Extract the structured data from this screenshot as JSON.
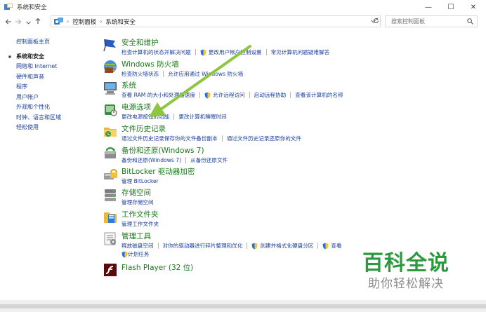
{
  "window": {
    "title": "系统和安全",
    "min_glyph": "—",
    "max_glyph": "☐",
    "close_glyph": "✕"
  },
  "address": {
    "breadcrumb": [
      "控制面板",
      "系统和安全"
    ],
    "search_placeholder": "搜索控制面板"
  },
  "sidebar": {
    "home": "控制面板主页",
    "items": [
      {
        "label": "系统和安全",
        "current": true
      },
      {
        "label": "网络和 Internet",
        "current": false
      },
      {
        "label": "硬件和声音",
        "current": false
      },
      {
        "label": "程序",
        "current": false
      },
      {
        "label": "用户帐户",
        "current": false
      },
      {
        "label": "外观和个性化",
        "current": false
      },
      {
        "label": "时钟、语言和区域",
        "current": false
      },
      {
        "label": "轻松使用",
        "current": false
      }
    ]
  },
  "categories": [
    {
      "title": "安全和维护",
      "icon": "flag-icon",
      "links": [
        {
          "text": "检查计算机的状态并解决问题",
          "shield": false
        },
        {
          "text": "更改用户帐户控制设置",
          "shield": true
        },
        {
          "text": "常见计算机问题疑难解答",
          "shield": false
        }
      ]
    },
    {
      "title": "Windows 防火墙",
      "icon": "firewall-icon",
      "links": [
        {
          "text": "检查防火墙状态",
          "shield": false
        },
        {
          "text": "允许应用通过 Windows 防火墙",
          "shield": false
        }
      ]
    },
    {
      "title": "系统",
      "icon": "computer-icon",
      "links": [
        {
          "text": "查看 RAM 的大小和处理器速度",
          "shield": false
        },
        {
          "text": "允许远程访问",
          "shield": true
        },
        {
          "text": "启动远程协助",
          "shield": false
        },
        {
          "text": "查看该计算机的名称",
          "shield": false
        }
      ]
    },
    {
      "title": "电源选项",
      "icon": "power-icon",
      "links": [
        {
          "text": "更改电源按钮的功能",
          "shield": false
        },
        {
          "text": "更改计算机睡眠时间",
          "shield": false
        }
      ]
    },
    {
      "title": "文件历史记录",
      "icon": "file-history-icon",
      "links": [
        {
          "text": "通过文件历史记录保存你的文件备份副本",
          "shield": false
        },
        {
          "text": "通过文件历史记录还原你的文件",
          "shield": false
        }
      ]
    },
    {
      "title": "备份和还原(Windows 7)",
      "icon": "backup-icon",
      "links": [
        {
          "text": "备份和还原(Windows 7)",
          "shield": false
        },
        {
          "text": "从备份还原文件",
          "shield": false
        }
      ]
    },
    {
      "title": "BitLocker 驱动器加密",
      "icon": "bitlocker-icon",
      "links": [
        {
          "text": "管理 BitLocker",
          "shield": false
        }
      ]
    },
    {
      "title": "存储空间",
      "icon": "storage-icon",
      "links": [
        {
          "text": "管理存储空间",
          "shield": false
        }
      ]
    },
    {
      "title": "工作文件夹",
      "icon": "work-folders-icon",
      "links": [
        {
          "text": "管理工作文件夹",
          "shield": false
        }
      ]
    },
    {
      "title": "管理工具",
      "icon": "admin-tools-icon",
      "links": [
        {
          "text": "释放磁盘空间",
          "shield": false
        },
        {
          "text": "对你的驱动器进行碎片整理和优化",
          "shield": false
        },
        {
          "text": "创建并格式化硬盘分区",
          "shield": true
        },
        {
          "text": "查看",
          "shield": true
        }
      ],
      "links2": [
        {
          "text": "计划任务",
          "shield": true
        }
      ]
    },
    {
      "title": "Flash Player (32 位)",
      "icon": "flash-icon",
      "links": []
    }
  ],
  "watermark": {
    "main": "百科全说",
    "sub": "助你轻松解决"
  },
  "colors": {
    "link": "#1a3e9e",
    "category_title": "#1a7a1a",
    "arrow": "#8dc63f",
    "watermark_green": "#2b9a3d"
  }
}
